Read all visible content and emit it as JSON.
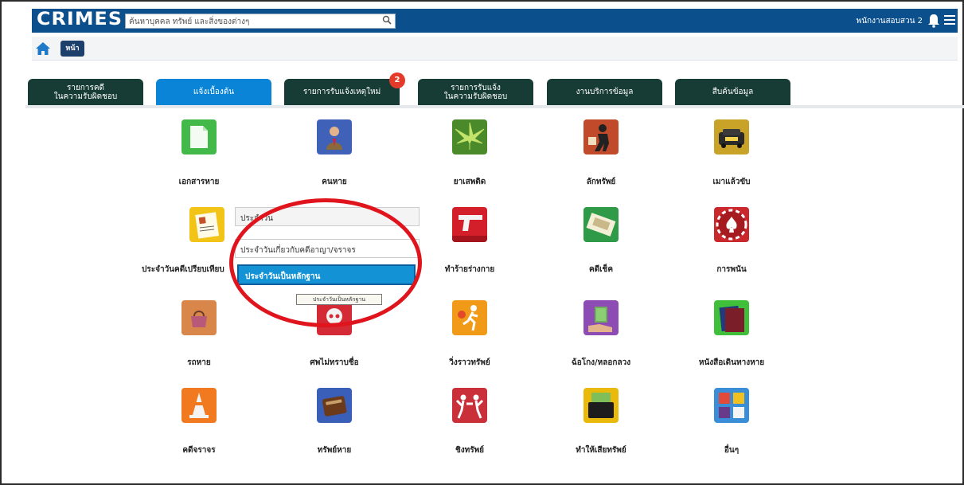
{
  "app": {
    "logo": "CRIMES",
    "search_placeholder": "ค้นหาบุคคล ทรัพย์ และสิ่งของต่างๆ",
    "user_name": "พนักงานสอบสวน 2"
  },
  "breadcrumb": {
    "button_label": "หน้าแรก"
  },
  "tabs": [
    {
      "label": "รายการคดี\nในความรับผิดชอบ",
      "active": false
    },
    {
      "label": "แจ้งเบื้องต้น",
      "active": true
    },
    {
      "label": "รายการรับแจ้งเหตุใหม่",
      "active": false,
      "badge": "2"
    },
    {
      "label": "รายการรับแจ้ง\nในความรับผิดชอบ",
      "active": false
    },
    {
      "label": "งานบริการข้อมูล",
      "active": false
    },
    {
      "label": "สืบค้นข้อมูล",
      "active": false
    }
  ],
  "grid": [
    {
      "label": "เอกสารหาย",
      "icon": "document-icon",
      "color": "#43b94a"
    },
    {
      "label": "คนหาย",
      "icon": "person-icon",
      "color": "#3f62b8"
    },
    {
      "label": "ยาเสพติด",
      "icon": "cannabis-leaf-icon",
      "color": "#4a8a2a"
    },
    {
      "label": "ลักทรัพย์",
      "icon": "thief-icon",
      "color": "#c14a2a"
    },
    {
      "label": "เมาแล้วขับ",
      "icon": "taxi-icon",
      "color": "#c9a327"
    },
    {
      "label": "ประจำวันคดีเปรียบเทียบ",
      "icon": "notebook-icon",
      "color": "#f2c418"
    },
    {
      "label": "",
      "icon": "",
      "color": ""
    },
    {
      "label": "ทำร้ายร่างกาย",
      "icon": "gun-icon",
      "color": "#d21f2a"
    },
    {
      "label": "คดีเช็ค",
      "icon": "cheque-icon",
      "color": "#2f9a47"
    },
    {
      "label": "การพนัน",
      "icon": "poker-chip-icon",
      "color": "#c9282c"
    },
    {
      "label": "รถหาย",
      "icon": "handbag-icon",
      "color": "#d9864a"
    },
    {
      "label": "ศพไม่ทราบชื่อ",
      "icon": "skull-icon",
      "color": "#d32a35"
    },
    {
      "label": "วิ่งราวทรัพย์",
      "icon": "runner-icon",
      "color": "#f19a18"
    },
    {
      "label": "ฉ้อโกง/หลอกลวง",
      "icon": "money-hand-icon",
      "color": "#8d4bb4"
    },
    {
      "label": "หนังสือเดินทางหาย",
      "icon": "passport-icon",
      "color": "#3fbf3a"
    },
    {
      "label": "คดีจราจร",
      "icon": "traffic-cone-icon",
      "color": "#f17a20"
    },
    {
      "label": "ทรัพย์หาย",
      "icon": "wallet-icon",
      "color": "#3a5fb8"
    },
    {
      "label": "ชิงทรัพย์",
      "icon": "robbery-icon",
      "color": "#c9303a"
    },
    {
      "label": "ทำให้เสียทรัพย์",
      "icon": "cash-wallet-icon",
      "color": "#e9b90c"
    },
    {
      "label": "อื่นๆ",
      "icon": "others-icon",
      "color": "#3a8ed8"
    }
  ],
  "dropdown": {
    "header": "ประจำวัน",
    "item1": "ประจำวันเกี่ยวกับคดีอาญา/จราจร",
    "item2": "ประจำวันเป็นหลักฐาน",
    "tooltip": "ประจำวันเป็นหลักฐาน"
  }
}
